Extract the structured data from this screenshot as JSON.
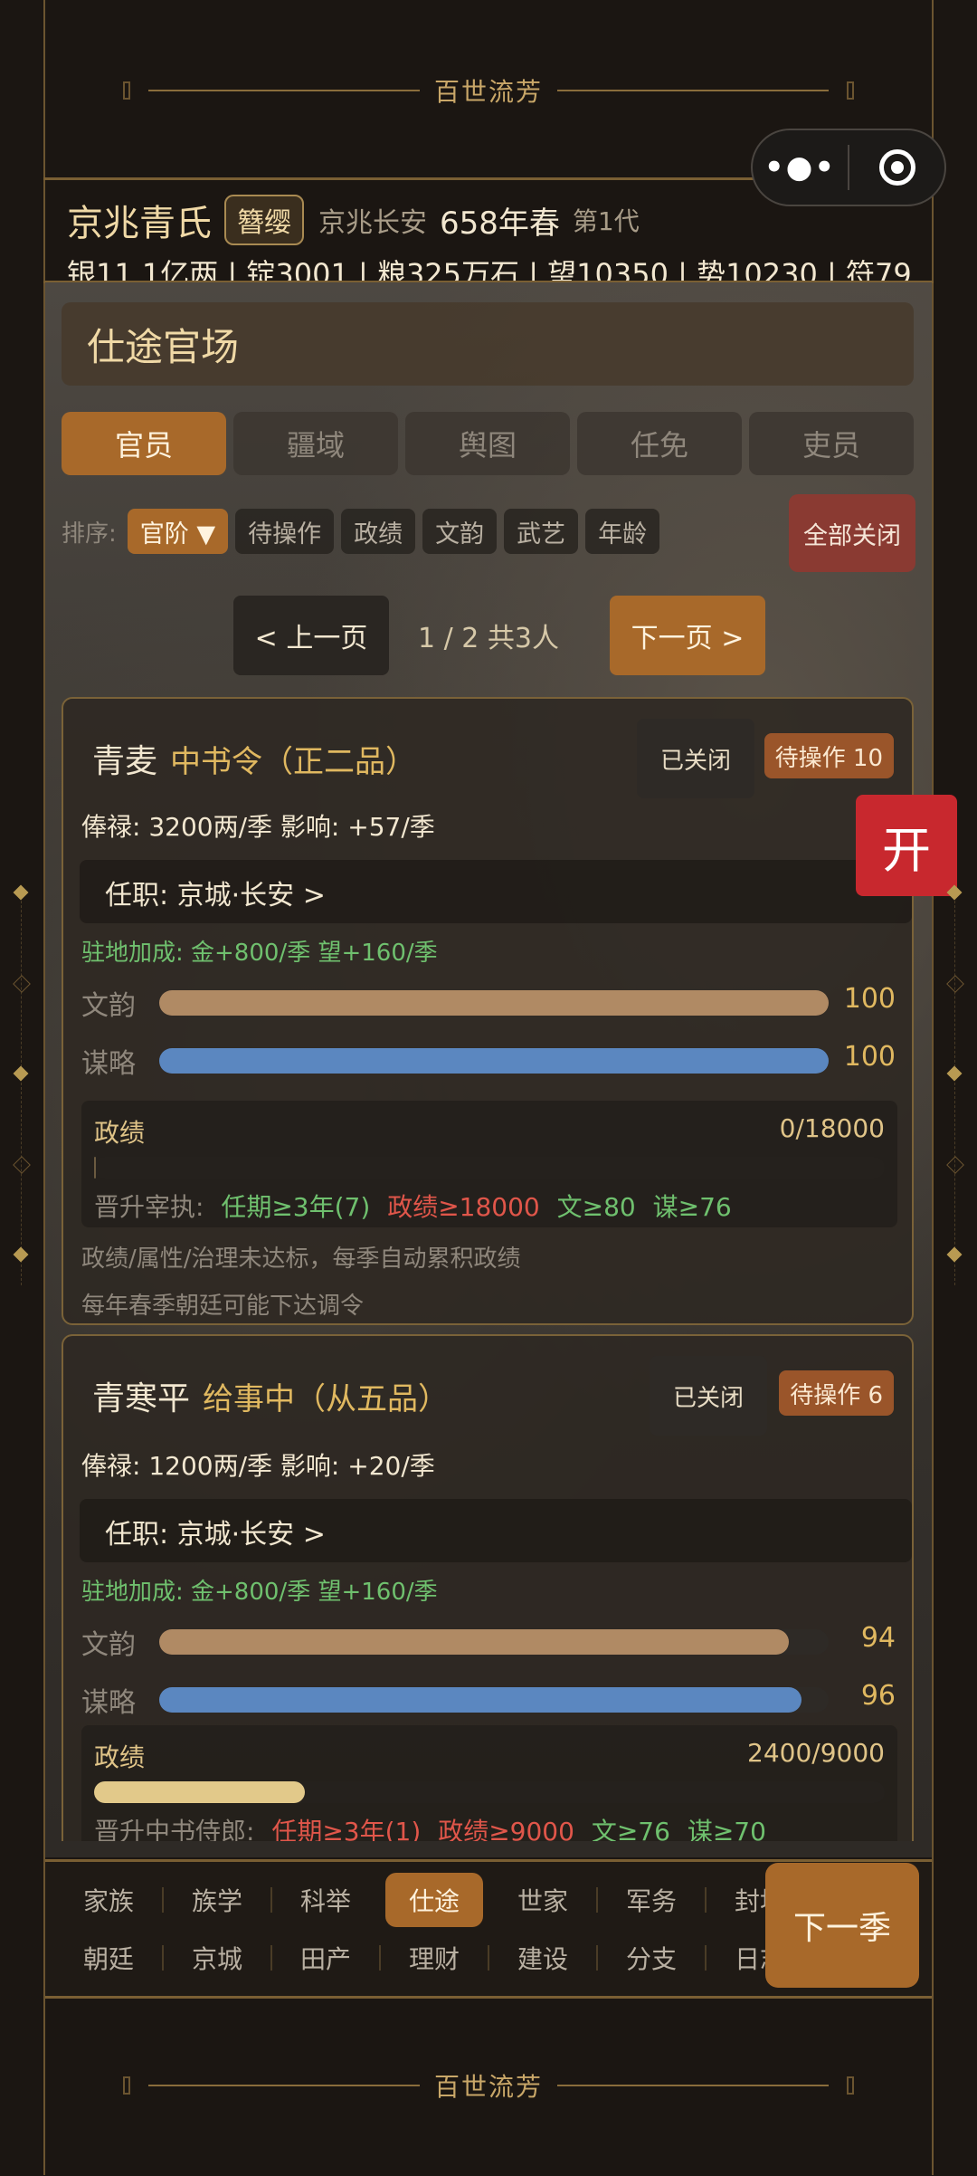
{
  "banner": {
    "title": "百世流芳"
  },
  "capsule": {
    "more": "•●•"
  },
  "header": {
    "clan": "京兆青氏",
    "badge": "簪缨",
    "location": "京兆长安",
    "year": "658年春",
    "generation": "第1代",
    "resources": "银11.1亿两 | 锭3001 | 粮325万石 | 望10350 | 势10230 | 符79"
  },
  "section": {
    "title": "仕途官场"
  },
  "tabs": [
    {
      "label": "官员",
      "active": true
    },
    {
      "label": "疆域"
    },
    {
      "label": "舆图"
    },
    {
      "label": "任免"
    },
    {
      "label": "吏员"
    }
  ],
  "sort": {
    "label": "排序:",
    "options": [
      "官阶 ▼",
      "待操作",
      "政绩",
      "文韵",
      "武艺",
      "年龄"
    ],
    "close_all": "全部关闭"
  },
  "pager": {
    "prev": "< 上一页",
    "info": "1 / 2  共3人",
    "next": "下一页 >"
  },
  "open_button": "开",
  "officials": [
    {
      "name": "青麦",
      "rank": "中书令（正二品）",
      "status": "已关闭",
      "pending": "待操作 10",
      "salary": "俸禄: 3200两/季   影响: +57/季",
      "post": "任职: 京城·长安  >",
      "bonus": "驻地加成: 金+800/季  望+160/季",
      "stats": [
        {
          "label": "文韵",
          "value": "100",
          "fraction": 1.0,
          "color": "#b08a64"
        },
        {
          "label": "谋略",
          "value": "100",
          "fraction": 1.0,
          "color": "#5b87c0"
        }
      ],
      "merit": {
        "label": "政绩",
        "value": "0/18000",
        "fraction": 0.0
      },
      "promotion": {
        "label": "晋升宰执:",
        "req1": "任期≥3年(7)",
        "req2": "政绩≥18000",
        "req3": "文≥80",
        "req4": "谋≥76"
      },
      "notes": [
        "政绩/属性/治理未达标，每季自动累积政绩",
        "每年春季朝廷可能下达调令"
      ]
    },
    {
      "name": "青寒平",
      "rank": "给事中（从五品）",
      "status": "已关闭",
      "pending": "待操作 6",
      "salary": "俸禄: 1200两/季   影响: +20/季",
      "post": "任职: 京城·长安  >",
      "bonus": "驻地加成: 金+800/季  望+160/季",
      "stats": [
        {
          "label": "文韵",
          "value": "94",
          "fraction": 0.94,
          "color": "#b08a64"
        },
        {
          "label": "谋略",
          "value": "96",
          "fraction": 0.96,
          "color": "#5b87c0"
        }
      ],
      "merit": {
        "label": "政绩",
        "value": "2400/9000",
        "fraction": 0.267
      },
      "promotion": {
        "label": "晋升中书侍郎:",
        "req1": "任期≥3年(1)",
        "req2": "政绩≥9000",
        "req3": "文≥76",
        "req4": "谋≥70"
      }
    }
  ],
  "nav": {
    "row1": [
      "家族",
      "族学",
      "科举",
      "仕途",
      "世家",
      "军务",
      "封地"
    ],
    "row2": [
      "朝廷",
      "京城",
      "田产",
      "理财",
      "建设",
      "分支",
      "日志"
    ],
    "active": "仕途",
    "next_season": "下一季"
  }
}
